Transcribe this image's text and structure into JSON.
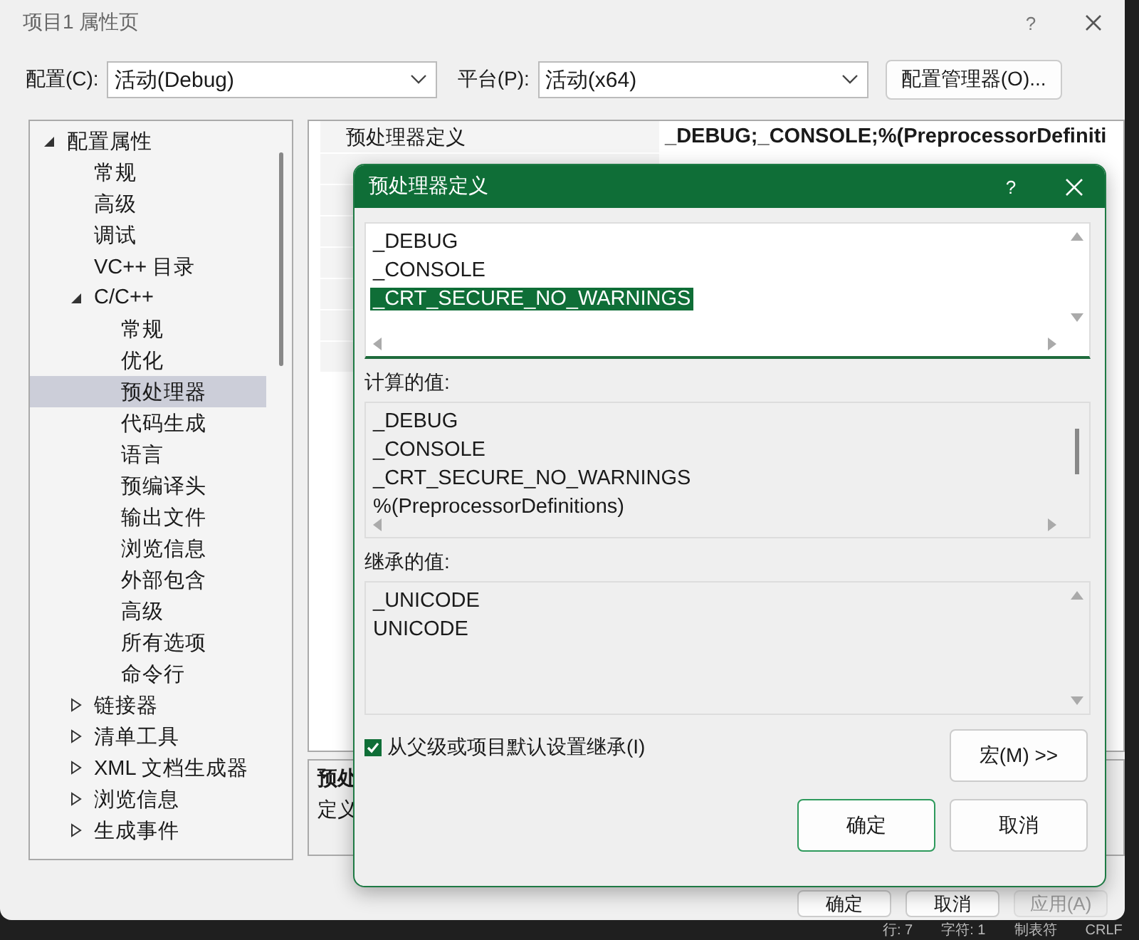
{
  "window": {
    "title": "项目1 属性页",
    "help": "?"
  },
  "toolbar": {
    "config_label": "配置(C):",
    "config_value": "活动(Debug)",
    "platform_label": "平台(P):",
    "platform_value": "活动(x64)",
    "manager_button": "配置管理器(O)..."
  },
  "tree": [
    {
      "label": "配置属性",
      "expanded": true,
      "selected": false,
      "children": [
        {
          "label": "常规",
          "selected": false
        },
        {
          "label": "高级",
          "selected": false
        },
        {
          "label": "调试",
          "selected": false
        },
        {
          "label": "VC++ 目录",
          "selected": false
        },
        {
          "label": "C/C++",
          "expanded": true,
          "selected": false,
          "children": [
            {
              "label": "常规",
              "selected": false
            },
            {
              "label": "优化",
              "selected": false
            },
            {
              "label": "预处理器",
              "selected": true
            },
            {
              "label": "代码生成",
              "selected": false
            },
            {
              "label": "语言",
              "selected": false
            },
            {
              "label": "预编译头",
              "selected": false
            },
            {
              "label": "输出文件",
              "selected": false
            },
            {
              "label": "浏览信息",
              "selected": false
            },
            {
              "label": "外部包含",
              "selected": false
            },
            {
              "label": "高级",
              "selected": false
            },
            {
              "label": "所有选项",
              "selected": false
            },
            {
              "label": "命令行",
              "selected": false
            }
          ]
        },
        {
          "label": "链接器",
          "expanded": false,
          "selected": false
        },
        {
          "label": "清单工具",
          "expanded": false,
          "selected": false
        },
        {
          "label": "XML 文档生成器",
          "expanded": false,
          "selected": false
        },
        {
          "label": "浏览信息",
          "expanded": false,
          "selected": false
        },
        {
          "label": "生成事件",
          "expanded": false,
          "selected": false
        }
      ]
    }
  ],
  "grid": {
    "rows": [
      {
        "name": "预处理器定义",
        "value": "_DEBUG;_CONSOLE;%(PreprocessorDefiniti"
      }
    ]
  },
  "description": {
    "title": "预处",
    "text": "定义"
  },
  "buttons": [
    {
      "label": "确定",
      "disabled": false
    },
    {
      "label": "取消",
      "disabled": false
    },
    {
      "label": "应用(A)",
      "disabled": true
    }
  ],
  "dialog": {
    "title": "预处理器定义",
    "help": "?",
    "edit_lines": [
      {
        "text": "_DEBUG",
        "selected": false
      },
      {
        "text": "_CONSOLE",
        "selected": false
      },
      {
        "text": "_CRT_SECURE_NO_WARNINGS",
        "selected": true
      }
    ],
    "computed_label": "计算的值:",
    "computed_lines": [
      "_DEBUG",
      "_CONSOLE",
      "_CRT_SECURE_NO_WARNINGS",
      "%(PreprocessorDefinitions)"
    ],
    "inherited_label": "继承的值:",
    "inherited_lines": [
      "_UNICODE",
      "UNICODE"
    ],
    "inherit_checkbox": {
      "label": "从父级或项目默认设置继承(I)",
      "checked": true
    },
    "macro_button": "宏(M) >>",
    "ok_button": "确定",
    "cancel_button": "取消"
  },
  "status_bar": [
    "行: 7",
    "字符: 1",
    "制表符",
    "CRLF"
  ]
}
